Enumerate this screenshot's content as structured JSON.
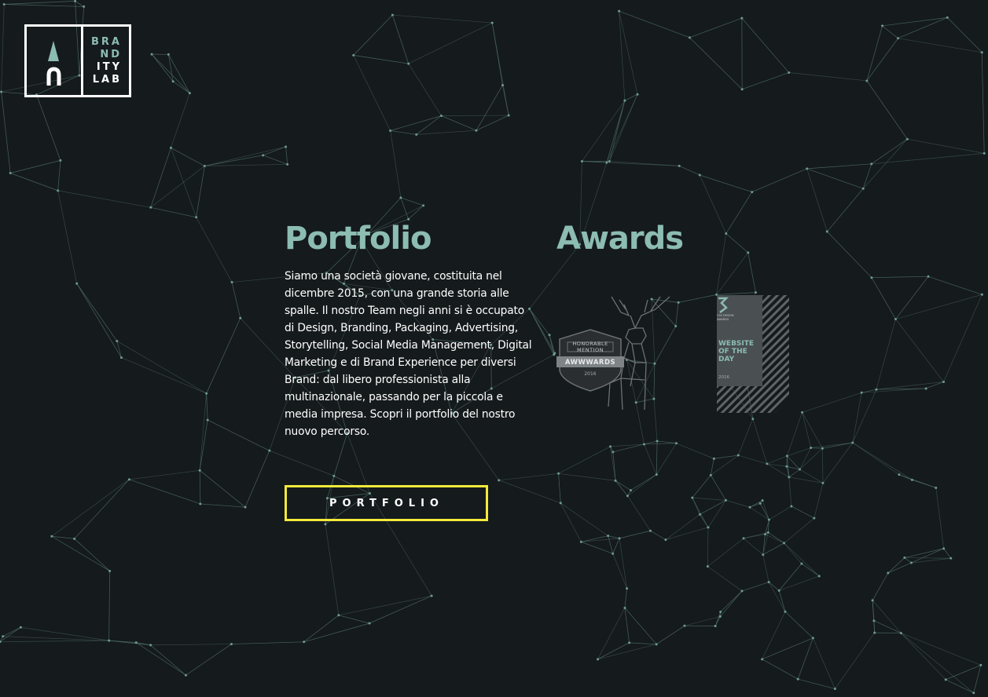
{
  "brand": {
    "logo_lines": [
      "BRA",
      "ND",
      "ITY",
      "LAB"
    ]
  },
  "portfolio": {
    "heading": "Portfolio",
    "description": "Siamo una società giovane, costituita nel dicembre 2015, con una grande storia alle spalle. Il nostro Team negli anni si è occupato di Design, Branding, Packaging, Advertising, Storytelling, Social Media Management, Digital Marketing e di Brand Experience per diversi Brand: dal libero professionista alla multinazionale, passando per la piccola e media impresa. Scopri il portfolio del nostro nuovo percorso.",
    "button_label": "PORTFOLIO"
  },
  "awards": {
    "heading": "Awards",
    "items": [
      {
        "ribbon": "HONORABLE MENTION",
        "name": "AWWWARDS",
        "year": "2016"
      },
      {
        "org": "CSS DESIGN AWARDS",
        "title": "WEBSITE OF THE DAY",
        "year": "2016"
      }
    ]
  },
  "colors": {
    "background": "#151a1c",
    "accent": "#8cbcb2",
    "button_border": "#f2ea3a",
    "text": "#ffffff"
  }
}
